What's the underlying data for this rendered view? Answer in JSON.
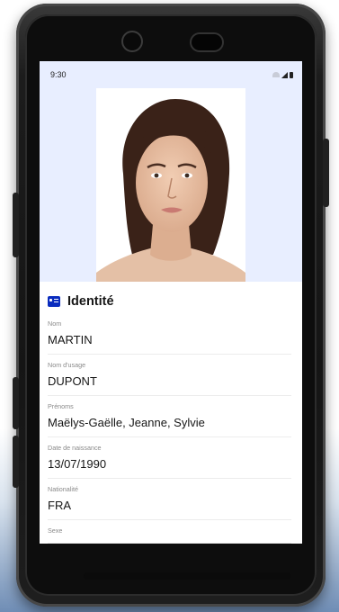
{
  "status_bar": {
    "time": "9:30",
    "icons": [
      "wifi-icon",
      "signal-icon",
      "battery-icon"
    ]
  },
  "identity": {
    "section_icon": "id-card-icon",
    "title": "Identité",
    "fields": [
      {
        "label": "Nom",
        "value": "MARTIN"
      },
      {
        "label": "Nom d'usage",
        "value": "DUPONT"
      },
      {
        "label": "Prénoms",
        "value": "Maëlys-Gaëlle, Jeanne, Sylvie"
      },
      {
        "label": "Date de naissance",
        "value": "13/07/1990"
      },
      {
        "label": "Nationalité",
        "value": "FRA"
      },
      {
        "label": "Sexe",
        "value": ""
      }
    ]
  },
  "colors": {
    "accent": "#0a2cbe",
    "header_bg": "#e8eeff"
  }
}
